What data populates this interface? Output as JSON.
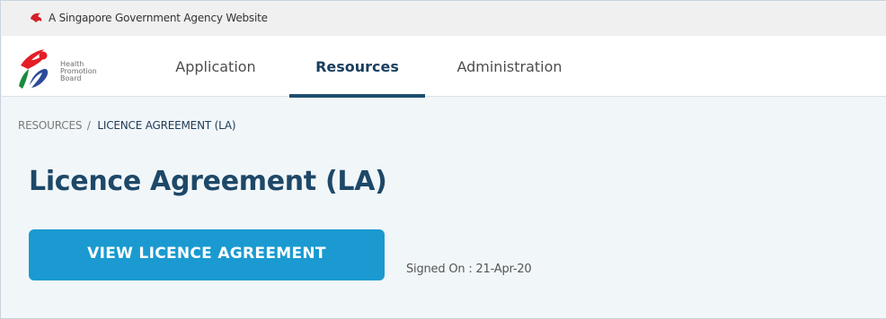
{
  "gov_bar": {
    "text": "A Singapore Government Agency Website",
    "icon": "lion-head-icon",
    "icon_color": "#d21f2b"
  },
  "header": {
    "logo": {
      "line1": "Health",
      "line2": "Promotion",
      "line3": "Board",
      "colors": [
        "#e31e25",
        "#1a8a3e",
        "#2c4b9b"
      ]
    },
    "nav": [
      {
        "label": "Application",
        "active": false
      },
      {
        "label": "Resources",
        "active": true
      },
      {
        "label": "Administration",
        "active": false
      }
    ]
  },
  "breadcrumb": {
    "root": "RESOURCES",
    "separator": "/",
    "current": "LICENCE AGREEMENT (LA)"
  },
  "page": {
    "title": "Licence Agreement (LA)",
    "view_button_label": "VIEW LICENCE AGREEMENT",
    "signed_on": "Signed On : 21-Apr-20",
    "accent_color": "#1a9ad0"
  }
}
